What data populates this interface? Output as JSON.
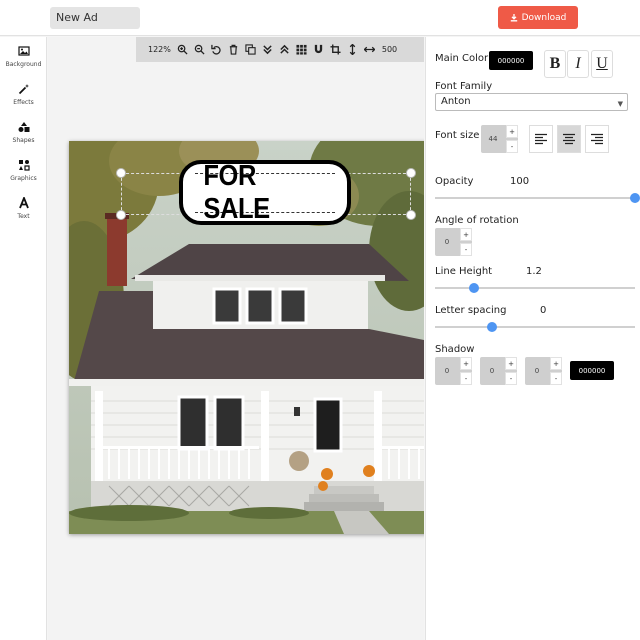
{
  "header": {
    "title_value": "New Ad",
    "download_label": "Download"
  },
  "sidebar": {
    "items": [
      {
        "label": "Background",
        "icon": "image-icon"
      },
      {
        "label": "Effects",
        "icon": "magic-wand-icon"
      },
      {
        "label": "Shapes",
        "icon": "shapes-icon"
      },
      {
        "label": "Graphics",
        "icon": "graphics-icon"
      },
      {
        "label": "Text",
        "icon": "text-icon"
      }
    ]
  },
  "toolbar": {
    "zoom": "122%",
    "canvas_size": "500"
  },
  "canvas": {
    "sign_text": "FOR SALE"
  },
  "panel": {
    "main_color_label": "Main Color",
    "main_color_value": "000000",
    "bold_label": "B",
    "italic_label": "I",
    "underline_label": "U",
    "font_family_label": "Font Family",
    "font_family_value": "Anton",
    "font_size_label": "Font size",
    "font_size_value": "44",
    "opacity_label": "Opacity",
    "opacity_value": "100",
    "rotation_label": "Angle of rotation",
    "rotation_value": "0",
    "line_height_label": "Line Height",
    "line_height_value": "1.2",
    "letter_spacing_label": "Letter spacing",
    "letter_spacing_value": "0",
    "shadow_label": "Shadow",
    "shadow_x": "0",
    "shadow_y": "0",
    "shadow_blur": "0",
    "shadow_color": "000000",
    "stepper_up": "+",
    "stepper_down": "-"
  },
  "colors": {
    "accent": "#ef5a47",
    "slider": "#4e95f2"
  }
}
